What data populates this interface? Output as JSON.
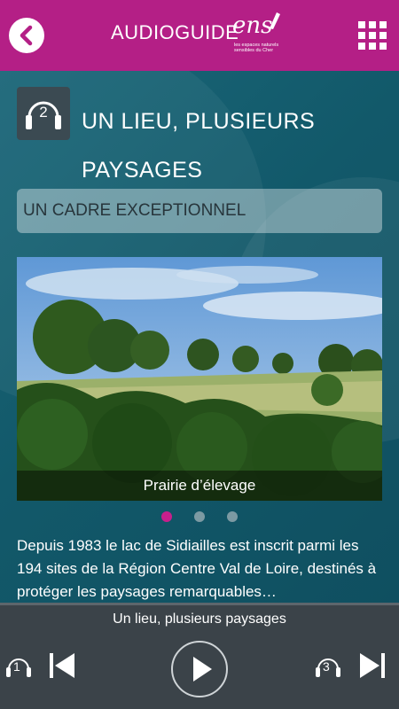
{
  "header": {
    "title": "AUDIOGUIDE",
    "logo_text": "ens",
    "logo_sub": "les espaces naturels sensibles du Cher",
    "background": "#b41f86",
    "icons": {
      "back": "chevron-left-icon",
      "menu": "grid-menu-icon"
    }
  },
  "track": {
    "number": "2",
    "icon": "headphones-icon",
    "title": "UN LIEU, PLUSIEURS PAYSAGES"
  },
  "section": {
    "label": "UN CADRE EXCEPTIONNEL"
  },
  "gallery": {
    "caption": "Prairie d’élevage",
    "slide_count": 3,
    "active_index": 0,
    "accent": "#c71f8c"
  },
  "description": "Depuis 1983 le lac de Sidiailles est inscrit parmi les 194 sites de la Région Centre Val de Loire, destinés à protéger les paysages remarquables…",
  "player": {
    "now_playing": "Un lieu, plusieurs paysages",
    "prev_track": "1",
    "next_track": "3",
    "icons": {
      "previous": "skip-previous-icon",
      "play": "play-icon",
      "next": "skip-next-icon"
    }
  }
}
